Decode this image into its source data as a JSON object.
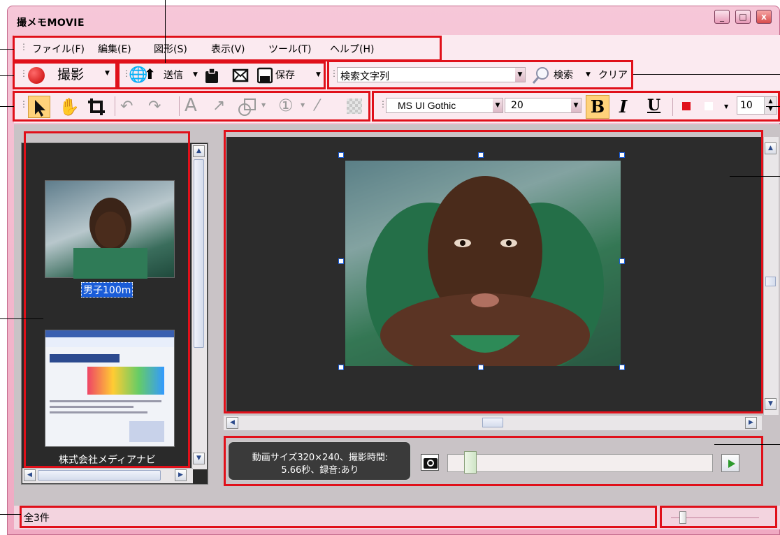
{
  "window": {
    "title": "撮メモMOVIE",
    "controls": [
      "_",
      "□",
      "x"
    ]
  },
  "menu": [
    "ファイル(F)",
    "編集(E)",
    "図形(S)",
    "表示(V)",
    "ツール(T)",
    "ヘルプ(H)"
  ],
  "toolbar1": {
    "record_label": "撮影",
    "send_label": "送信",
    "save_label": "保存",
    "search_placeholder": "検索文字列",
    "search_label": "検索",
    "clear_label": "クリア"
  },
  "toolbar2": {
    "font_name": "MS UI Gothic",
    "font_size": "20",
    "bold": "B",
    "italic": "I",
    "underline": "U",
    "line_width": "10",
    "text_tool": "A",
    "number_tool": "①"
  },
  "thumbnails": [
    {
      "label": "男子100m",
      "selected": true
    },
    {
      "label": "株式会社メディアナビ",
      "selected": false
    }
  ],
  "info": {
    "line1": "動画サイズ320×240、撮影時間:",
    "line2": "5.66秒、録音:あり"
  },
  "status": {
    "count": "全3件"
  },
  "colors": {
    "accent_red": "#e0101a",
    "record_red": "#cc0000",
    "selection_blue": "#1a5cd7"
  }
}
